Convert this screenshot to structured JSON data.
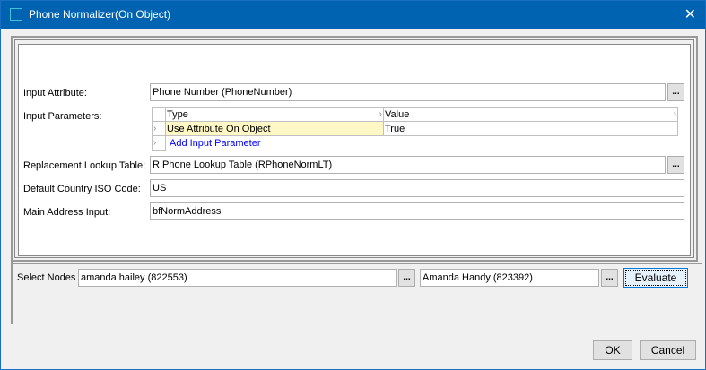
{
  "window": {
    "title": "Phone Normalizer(On Object)",
    "close_icon": "close-icon"
  },
  "form": {
    "input_attribute": {
      "label": "Input Attribute:",
      "value": "Phone Number (PhoneNumber)",
      "browse": "..."
    },
    "input_parameters": {
      "label": "Input Parameters:",
      "columns": [
        "Type",
        "Value"
      ],
      "rows": [
        {
          "type": "Use Attribute On Object",
          "value": "True"
        }
      ],
      "add_link": "Add Input Parameter"
    },
    "replacement_lookup": {
      "label": "Replacement Lookup Table:",
      "value": "R Phone Lookup Table (RPhoneNormLT)",
      "browse": "..."
    },
    "country_iso": {
      "label": "Default Country ISO Code:",
      "value": "US"
    },
    "main_address": {
      "label": "Main Address Input:",
      "value": "bfNormAddress"
    }
  },
  "select_nodes": {
    "label": "Select Nodes",
    "node1": "amanda hailey (822553)",
    "node2": "Amanda Handy (823392)",
    "browse": "...",
    "evaluate": "Evaluate"
  },
  "footer": {
    "ok": "OK",
    "cancel": "Cancel"
  },
  "colors": {
    "titlebar": "#0063b1",
    "highlight": "#fff8c6",
    "link": "#0000ff"
  }
}
